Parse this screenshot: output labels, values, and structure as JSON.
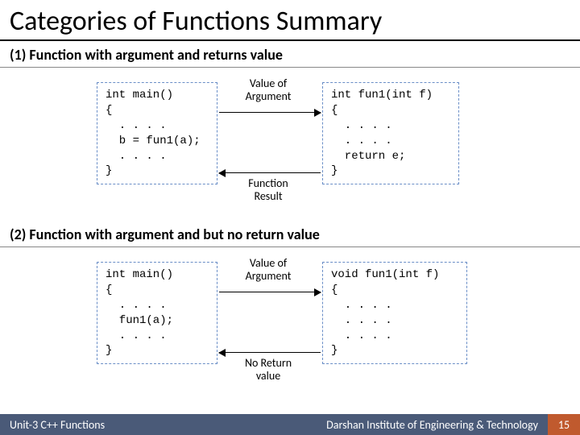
{
  "title": "Categories of Functions Summary",
  "section1": {
    "heading": "(1) Function with argument and returns value",
    "left_code": "int main()\n{\n  . . . .\n  b = fun1(a);\n  . . . .\n}",
    "right_code": "int fun1(int f)\n{\n  . . . .\n  . . . .\n  return e;\n}",
    "label_top": "Value of\nArgument",
    "label_bottom": "Function\nResult"
  },
  "section2": {
    "heading": "(2) Function with argument and but no return value",
    "left_code": "int main()\n{\n  . . . .\n  fun1(a);\n  . . . .\n}",
    "right_code": "void fun1(int f)\n{\n  . . . .\n  . . . .\n  . . . .\n}",
    "label_top": "Value of\nArgument",
    "label_bottom": "No Return\nvalue"
  },
  "footer": {
    "unit": "Unit-3 C++ Functions",
    "institute": "Darshan Institute of Engineering & Technology",
    "page": "15"
  }
}
